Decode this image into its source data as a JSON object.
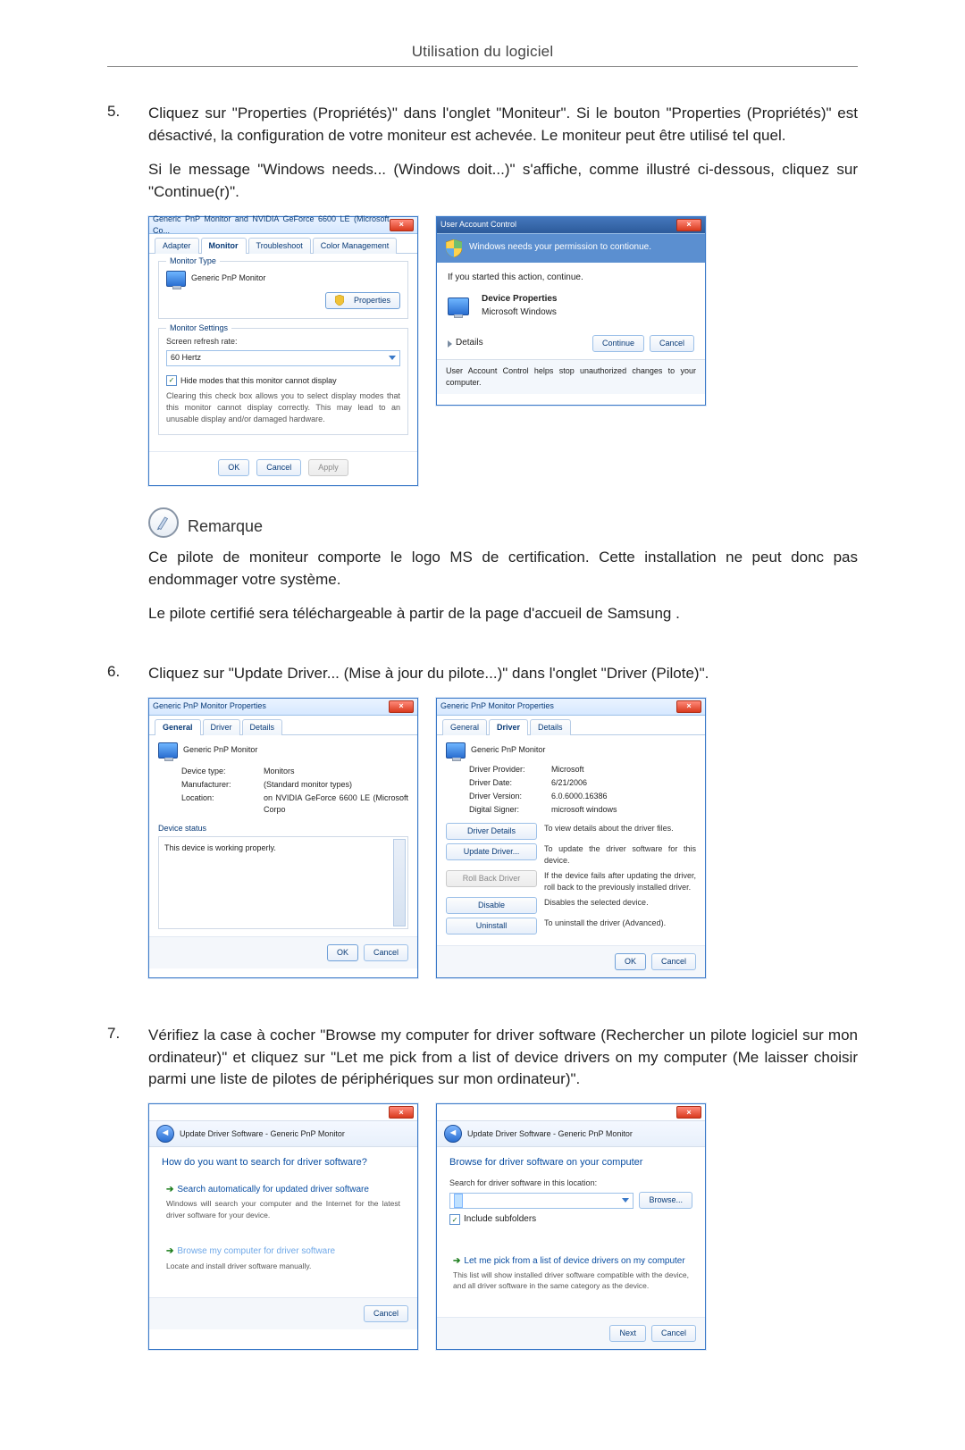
{
  "page_header": "Utilisation du logiciel",
  "step5": {
    "num": "5.",
    "para1": "Cliquez sur \"Properties (Propriétés)\" dans l'onglet \"Moniteur\". Si le bouton \"Properties (Propriétés)\" est désactivé, la configuration de votre moniteur est achevée. Le moniteur peut être utilisé tel quel.",
    "para2": "Si le message \"Windows needs... (Windows doit...)\" s'affiche, comme illustré ci-dessous, cliquez sur \"Continue(r)\".",
    "dlg_left": {
      "title": "Generic PnP Monitor and NVIDIA GeForce 6600 LE (Microsoft Co...",
      "tabs": [
        "Adapter",
        "Monitor",
        "Troubleshoot",
        "Color Management"
      ],
      "group_monitor_type": "Monitor Type",
      "device_name": "Generic PnP Monitor",
      "properties_btn": "Properties",
      "group_monitor_settings": "Monitor Settings",
      "refresh_label": "Screen refresh rate:",
      "refresh_value": "60 Hertz",
      "hide_modes_chk": "Hide modes that this monitor cannot display",
      "hide_modes_note": "Clearing this check box allows you to select display modes that this monitor cannot display correctly. This may lead to an unusable display and/or damaged hardware.",
      "ok": "OK",
      "cancel": "Cancel",
      "apply": "Apply"
    },
    "dlg_right": {
      "title": "User Account Control",
      "headline": "Windows needs your permission to contionue.",
      "if_started": "If you started this action, continue.",
      "item_title": "Device Properties",
      "item_pub": "Microsoft Windows",
      "details": "Details",
      "continue": "Continue",
      "cancel": "Cancel",
      "footer": "User Account Control helps stop unauthorized changes to your computer."
    }
  },
  "remark_label": "Remarque",
  "remark_p1": "Ce pilote de moniteur comporte le logo MS de certification. Cette installation ne peut donc pas endommager votre système.",
  "remark_p2": "Le pilote certifié sera téléchargeable à partir de la page d'accueil de Samsung .",
  "step6": {
    "num": "6.",
    "text": "Cliquez sur \"Update Driver... (Mise à jour du pilote...)\" dans l'onglet \"Driver (Pilote)\".",
    "dlg_left": {
      "title": "Generic PnP Monitor Properties",
      "tabs": [
        "General",
        "Driver",
        "Details"
      ],
      "device_name": "Generic PnP Monitor",
      "rows": {
        "device_type_l": "Device type:",
        "device_type_v": "Monitors",
        "manufacturer_l": "Manufacturer:",
        "manufacturer_v": "(Standard monitor types)",
        "location_l": "Location:",
        "location_v": "on NVIDIA GeForce 6600 LE (Microsoft Corpo"
      },
      "status_group": "Device status",
      "status_text": "This device is working properly.",
      "ok": "OK",
      "cancel": "Cancel"
    },
    "dlg_right": {
      "title": "Generic PnP Monitor Properties",
      "tabs": [
        "General",
        "Driver",
        "Details"
      ],
      "device_name": "Generic PnP Monitor",
      "rows": {
        "provider_l": "Driver Provider:",
        "provider_v": "Microsoft",
        "date_l": "Driver Date:",
        "date_v": "6/21/2006",
        "version_l": "Driver Version:",
        "version_v": "6.0.6000.16386",
        "signer_l": "Digital Signer:",
        "signer_v": "microsoft windows"
      },
      "btn_details": "Driver Details",
      "btn_details_desc": "To view details about the driver files.",
      "btn_update": "Update Driver...",
      "btn_update_desc": "To update the driver software for this device.",
      "btn_rollback": "Roll Back Driver",
      "btn_rollback_desc": "If the device fails after updating the driver, roll back to the previously installed driver.",
      "btn_disable": "Disable",
      "btn_disable_desc": "Disables the selected device.",
      "btn_uninstall": "Uninstall",
      "btn_uninstall_desc": "To uninstall the driver (Advanced).",
      "ok": "OK",
      "cancel": "Cancel"
    }
  },
  "step7": {
    "num": "7.",
    "text": "Vérifiez la case à cocher \"Browse my computer for driver software (Rechercher un pilote logiciel sur mon ordinateur)\" et cliquez sur \"Let me pick from a list of device drivers on my computer (Me laisser choisir parmi une liste de pilotes de périphériques sur mon ordinateur)\".",
    "dlg_left": {
      "crumb": "Update Driver Software - Generic PnP Monitor",
      "heading": "How do you want to search for driver software?",
      "opt1_title": "Search automatically for updated driver software",
      "opt1_sub": "Windows will search your computer and the Internet for the latest driver software for your device.",
      "opt2_title": "Browse my computer for driver software",
      "opt2_sub": "Locate and install driver software manually.",
      "cancel": "Cancel"
    },
    "dlg_right": {
      "crumb": "Update Driver Software - Generic PnP Monitor",
      "heading": "Browse for driver software on your computer",
      "search_label": "Search for driver software in this location:",
      "browse": "Browse...",
      "include_sub": "Include subfolders",
      "opt_title": "Let me pick from a list of device drivers on my computer",
      "opt_sub": "This list will show installed driver software compatible with the device, and all driver software in the same category as the device.",
      "next": "Next",
      "cancel": "Cancel"
    }
  }
}
